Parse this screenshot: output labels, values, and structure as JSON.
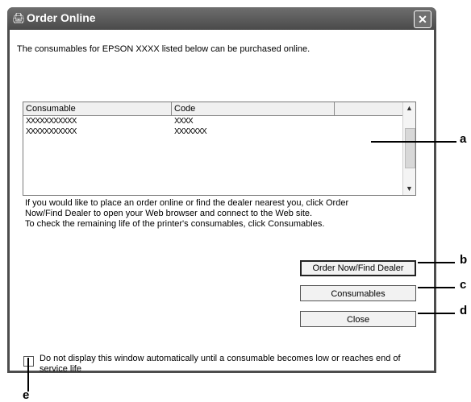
{
  "window": {
    "title": "Order Online",
    "close_glyph": "✕"
  },
  "intro_text": "The consumables for EPSON XXXX listed below can be purchased online.",
  "list": {
    "columns": [
      "Consumable",
      "Code"
    ],
    "rows": [
      {
        "consumable": "XXXXXXXXXXX",
        "code": "XXXX"
      },
      {
        "consumable": "XXXXXXXXXXX",
        "code": "XXXXXXX"
      }
    ]
  },
  "help_text": [
    "If you would like to place an order online or find the dealer nearest you, click Order",
    "Now/Find Dealer to open your Web browser and connect to the Web site.",
    "To check the remaining life of the printer's consumables, click Consumables."
  ],
  "buttons": {
    "order": "Order Now/Find Dealer",
    "consumables": "Consumables",
    "close": "Close"
  },
  "checkbox": {
    "checked": false,
    "label": "Do not display this window automatically until a consumable becomes low or reaches end of service life"
  },
  "callouts": {
    "a": "a",
    "b": "b",
    "c": "c",
    "d": "d",
    "e": "e"
  },
  "icons": [
    "printer-icon",
    "close-icon",
    "scroll-up-icon",
    "scroll-down-icon"
  ]
}
